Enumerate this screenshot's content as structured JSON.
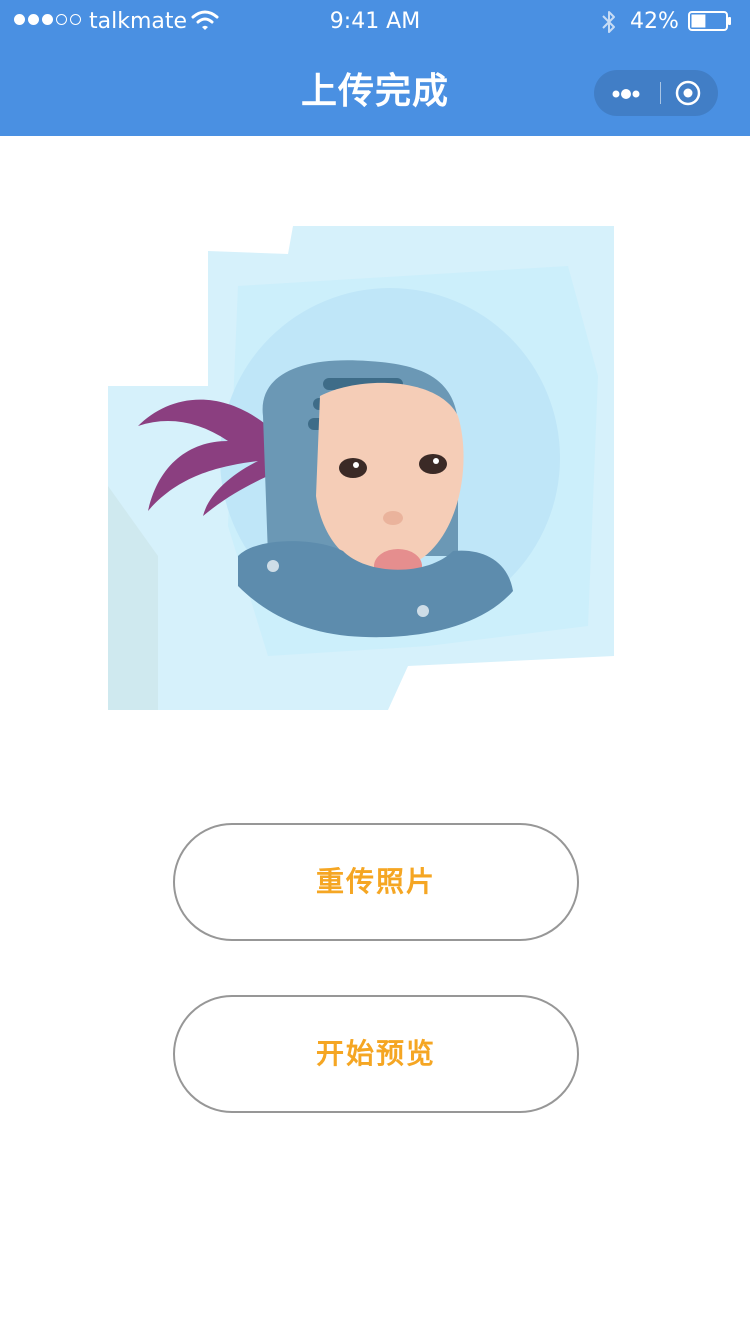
{
  "status_bar": {
    "carrier": "talkmate",
    "time": "9:41 AM",
    "battery_percent": "42%",
    "battery_level": 0.42,
    "signal_bars_filled": 3,
    "signal_bars_total": 5
  },
  "nav": {
    "title": "上传完成",
    "more_icon": "more-dots-icon",
    "close_icon": "target-circle-icon"
  },
  "buttons": {
    "reupload_label": "重传照片",
    "preview_label": "开始预览"
  },
  "colors": {
    "header_bg": "#4a90e2",
    "button_text": "#f5a623",
    "button_border": "#979797"
  }
}
